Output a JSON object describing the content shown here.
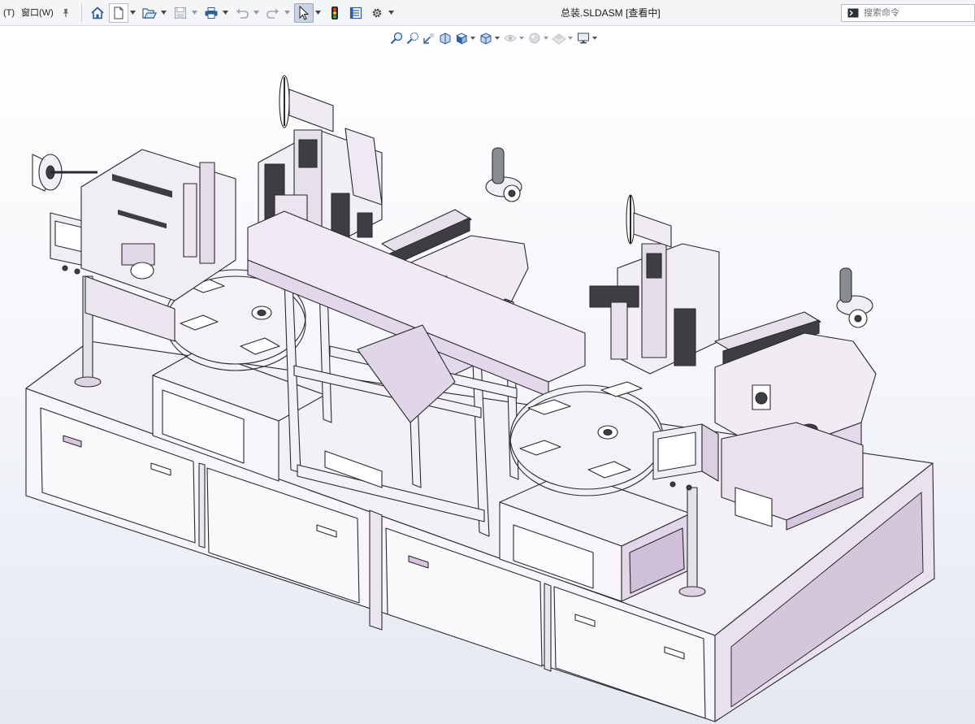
{
  "menubar": {
    "items": [
      {
        "label": "(T)"
      },
      {
        "label": "窗口(W)"
      }
    ]
  },
  "toolbar": {
    "buttons": [
      {
        "icon": "home-icon",
        "has_dropdown": false
      },
      {
        "icon": "new-document-icon",
        "has_dropdown": true
      },
      {
        "icon": "open-folder-icon",
        "has_dropdown": true
      },
      {
        "icon": "save-icon",
        "has_dropdown": true
      },
      {
        "icon": "print-icon",
        "has_dropdown": true
      },
      {
        "icon": "undo-icon",
        "has_dropdown": true
      },
      {
        "icon": "redo-icon",
        "has_dropdown": true
      },
      {
        "icon": "select-arrow-icon",
        "has_dropdown": true,
        "pressed": true
      },
      {
        "icon": "rebuild-traffic-light-icon",
        "has_dropdown": false
      },
      {
        "icon": "file-properties-icon",
        "has_dropdown": false
      },
      {
        "icon": "options-gear-icon",
        "has_dropdown": true
      }
    ]
  },
  "document": {
    "title": "总装.SLDASM [查看中]"
  },
  "search": {
    "placeholder": "搜索命令"
  },
  "heads_up_toolbar": {
    "buttons": [
      {
        "icon": "zoom-to-fit-icon"
      },
      {
        "icon": "zoom-to-area-icon"
      },
      {
        "icon": "previous-view-icon"
      },
      {
        "icon": "section-view-icon"
      },
      {
        "icon": "view-orientation-icon",
        "has_dropdown": true
      },
      {
        "icon": "display-style-icon",
        "has_dropdown": true
      },
      {
        "icon": "hide-show-items-icon",
        "has_dropdown": true
      },
      {
        "icon": "edit-appearance-icon",
        "has_dropdown": true
      },
      {
        "icon": "apply-scene-icon",
        "has_dropdown": true
      },
      {
        "icon": "view-settings-icon",
        "has_dropdown": true
      }
    ]
  },
  "graphics_area": {
    "content": "3d-assembly-model",
    "colors": {
      "background_top": "#ffffff",
      "background_bottom": "#e4e8f1",
      "model_face": "#f4f1f6",
      "model_shade": "#ddd3e2",
      "model_accent": "#c8b6cf",
      "edge": "#2a2a2e",
      "dark_parts": "#3d3e44"
    }
  }
}
